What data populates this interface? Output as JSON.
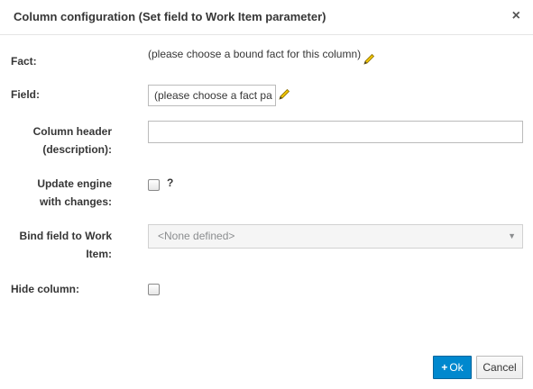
{
  "dialog": {
    "title": "Column configuration (Set field to Work Item parameter)",
    "close_label": "×"
  },
  "form": {
    "fact": {
      "label": "Fact:",
      "value": "(please choose a bound fact for this column)",
      "edit_icon": "pencil-icon"
    },
    "field": {
      "label": "Field:",
      "value": "(please choose a fact pa",
      "edit_icon": "pencil-icon"
    },
    "column_header": {
      "label_line1": "Column header",
      "label_line2": "(description):",
      "value": ""
    },
    "update_engine": {
      "label_line1": "Update engine",
      "label_line2": "with changes:",
      "checked": false,
      "help": "?"
    },
    "bind_field": {
      "label_line1": "Bind field to Work",
      "label_line2": "Item:",
      "selected": "<None defined>",
      "disabled": true
    },
    "hide_column": {
      "label": "Hide column:",
      "checked": false
    }
  },
  "footer": {
    "ok_label": "Ok",
    "ok_icon": "plus-icon",
    "cancel_label": "Cancel"
  },
  "colors": {
    "primary": "#0088ce",
    "text": "#363636",
    "pencil": "#c8a100"
  }
}
